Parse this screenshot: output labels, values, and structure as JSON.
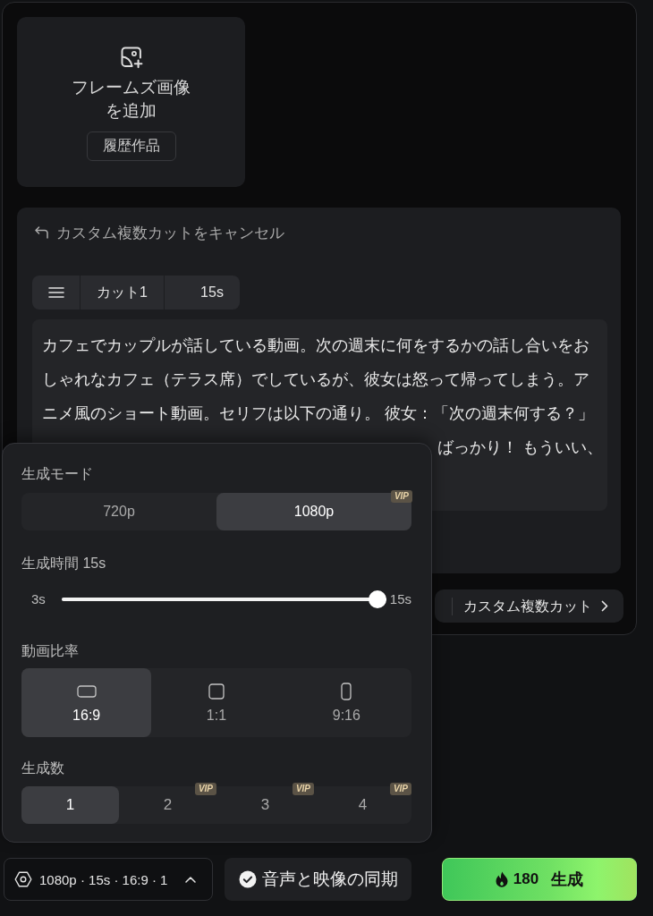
{
  "frames_card": {
    "label": "フレームズ画像を追加",
    "history_button": "履歴作品"
  },
  "cut_editor": {
    "cancel_link": "カスタム複数カットをキャンセル",
    "cut_tab": {
      "name": "カット1",
      "duration": "15s"
    },
    "prompt": {
      "value": "カフェでカップルが話している動画。次の週末に何をするかの話し合いをおしゃれなカフェ（テラス席）でしているが、彼女は怒って帰ってしまう。アニメ風のショート動画。セリフは以下の通り。 彼女：「次の週末何する？」",
      "visible_fragment": "ばっかり！ もういい、"
    }
  },
  "cut_mode_bar": {
    "custom_cuts_button": "カスタム複数カット"
  },
  "settings_popup": {
    "mode": {
      "label": "生成モード",
      "options": [
        {
          "label": "720p",
          "selected": false
        },
        {
          "label": "1080p",
          "selected": true,
          "badge": "VIP"
        }
      ]
    },
    "duration": {
      "label": "生成時間 15s",
      "min_label": "3s",
      "max_label": "15s",
      "level": 1
    },
    "ratio": {
      "label": "動画比率",
      "options": [
        {
          "label": "16:9",
          "kind": "landscape",
          "selected": true
        },
        {
          "label": "1:1",
          "kind": "square",
          "selected": false
        },
        {
          "label": "9:16",
          "kind": "portrait",
          "selected": false
        }
      ]
    },
    "count": {
      "label": "生成数",
      "options": [
        {
          "label": "1",
          "selected": true
        },
        {
          "label": "2",
          "selected": false,
          "badge": "VIP"
        },
        {
          "label": "3",
          "selected": false,
          "badge": "VIP"
        },
        {
          "label": "4",
          "selected": false,
          "badge": "VIP"
        }
      ]
    }
  },
  "bottom_bar": {
    "summary": "1080p · 15s · 16:9 · 1",
    "sync_button": {
      "label": "音声と映像の同期",
      "checked": true
    },
    "generate_button": {
      "cost": "180",
      "label": "生成"
    }
  }
}
